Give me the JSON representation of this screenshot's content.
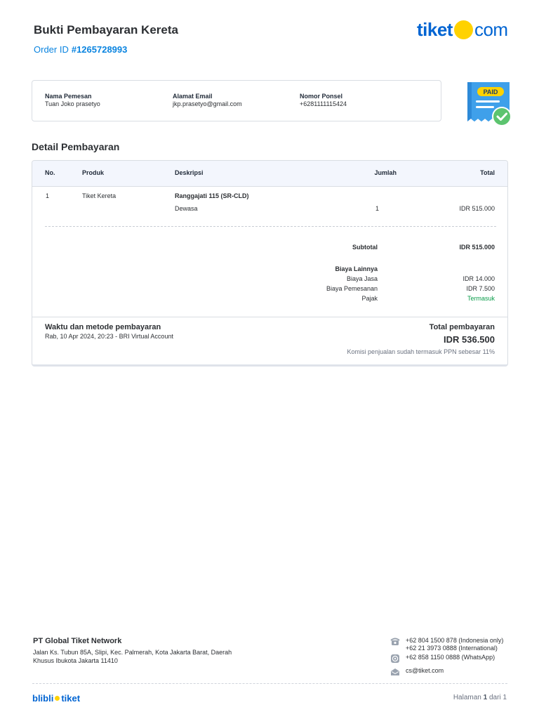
{
  "header": {
    "title": "Bukti Pembayaran Kereta",
    "order_label": "Order ID",
    "order_id": "#1265728993",
    "logo_left": "tiket",
    "logo_right": "com"
  },
  "customer": {
    "name_label": "Nama Pemesan",
    "name": "Tuan Joko prasetyo",
    "email_label": "Alamat Email",
    "email": "jkp.prasetyo@gmail.com",
    "phone_label": "Nomor Ponsel",
    "phone": "+6281111115424"
  },
  "badge": {
    "text": "PAID"
  },
  "details": {
    "section_title": "Detail Pembayaran",
    "columns": {
      "no": "No.",
      "produk": "Produk",
      "deskripsi": "Deskripsi",
      "jumlah": "Jumlah",
      "total": "Total"
    },
    "rows": [
      {
        "no": "1",
        "produk": "Tiket Kereta",
        "desc_title": "Ranggajati 115 (SR-CLD)",
        "desc_sub": "Dewasa",
        "jumlah": "1",
        "total": "IDR 515.000"
      }
    ],
    "subtotal_label": "Subtotal",
    "subtotal_value": "IDR 515.000",
    "other_fees_label": "Biaya Lainnya",
    "fees": [
      {
        "label": "Biaya Jasa",
        "value": "IDR 14.000"
      },
      {
        "label": "Biaya Pemesanan",
        "value": "IDR 7.500"
      },
      {
        "label": "Pajak",
        "value": "Termasuk"
      }
    ]
  },
  "payment": {
    "method_title": "Waktu dan metode pembayaran",
    "method_value": "Rab, 10 Apr 2024, 20:23 - BRI Virtual Account",
    "total_label": "Total pembayaran",
    "total_value": "IDR 536.500",
    "note": "Komisi penjualan sudah termasuk PPN sebesar 11%"
  },
  "footer": {
    "company": "PT Global Tiket Network",
    "address": "Jalan Ks. Tubun 85A, Slipi, Kec. Palmerah, Kota Jakarta Barat, Daerah Khusus Ibukota Jakarta 11410",
    "phone_1": "+62 804 1500 878 (Indonesia only)",
    "phone_2": "+62 21 3973 0888 (International)",
    "whatsapp": "+62 858 1150 0888 (WhatsApp)",
    "email": "cs@tiket.com",
    "brand_left": "blibli",
    "brand_right": "tiket",
    "page_prefix": "Halaman",
    "page_current": "1",
    "page_suffix": "dari 1"
  },
  "colors": {
    "brand_blue": "#0064d2",
    "accent_yellow": "#ffd200",
    "link_blue": "#0a84e0",
    "status_green": "#0a9c4a"
  }
}
